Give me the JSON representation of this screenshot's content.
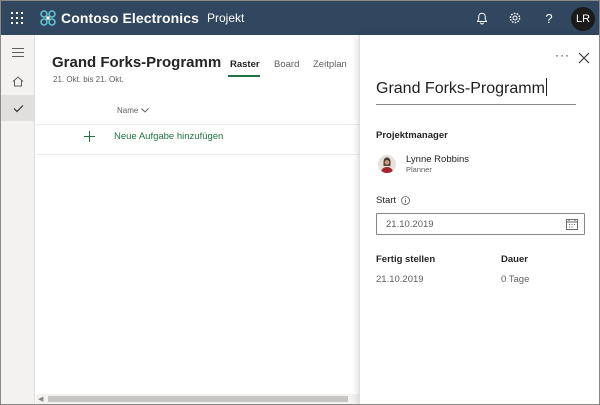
{
  "header": {
    "brand_name": "Contoso Electronics",
    "app_name": "Projekt",
    "avatar_initials": "LR",
    "icons": [
      "waffle-icon",
      "contoso-logo-icon",
      "bell-icon",
      "gear-icon",
      "help-icon"
    ],
    "colors": {
      "background": "#31465f",
      "text": "#ffffff"
    }
  },
  "rail": {
    "items": [
      {
        "icon": "hamburger-icon",
        "active": false
      },
      {
        "icon": "home-icon",
        "active": false
      },
      {
        "icon": "checkmark-icon",
        "active": true
      }
    ]
  },
  "plan": {
    "title": "Grand Forks-Programm",
    "dates": "21. Okt. bis 21. Okt.",
    "tabs": [
      {
        "label": "Raster",
        "active": true
      },
      {
        "label": "Board",
        "active": false
      },
      {
        "label": "Zeitplan",
        "active": false
      }
    ],
    "column_header": "Name",
    "add_task_label": "Neue Aufgabe hinzufügen",
    "accent_color": "#217346"
  },
  "details": {
    "more_label": "···",
    "title_value": "Grand Forks-Programm",
    "project_manager_label": "Projektmanager",
    "manager": {
      "name": "Lynne Robbins",
      "role": "Planner"
    },
    "start_label": "Start",
    "start_value": "21.10.2019",
    "finish_label": "Fertig stellen",
    "finish_value": "21.10.2019",
    "duration_label": "Dauer",
    "duration_value": "0 Tage"
  }
}
